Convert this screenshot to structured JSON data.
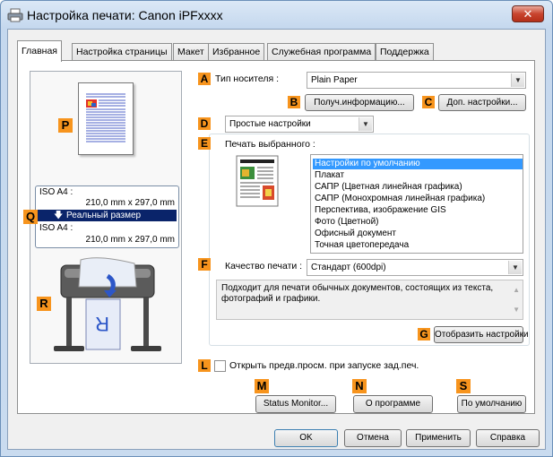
{
  "window": {
    "title": "Настройка печати: Canon iPFxxxx",
    "close_glyph": "✕"
  },
  "tabs": [
    {
      "label": "Главная",
      "active": true
    },
    {
      "label": "Настройка страницы"
    },
    {
      "label": "Макет"
    },
    {
      "label": "Избранное"
    },
    {
      "label": "Служебная программа"
    },
    {
      "label": "Поддержка"
    }
  ],
  "markers": {
    "A": "A",
    "B": "B",
    "C": "C",
    "D": "D",
    "E": "E",
    "F": "F",
    "G": "G",
    "L": "L",
    "M": "M",
    "N": "N",
    "S": "S",
    "P": "P",
    "Q": "Q",
    "R": "R"
  },
  "media": {
    "label": "Тип носителя :",
    "value": "Plain Paper",
    "get_info_button": "Получ.информацию...",
    "advanced_button": "Доп. настройки..."
  },
  "mode": {
    "value": "Простые настройки"
  },
  "print_target": {
    "label": "Печать выбранного :",
    "items": [
      "Настройки по умолчанию",
      "Плакат",
      "САПР (Цветная линейная графика)",
      "САПР (Монохромная линейная графика)",
      "Перспектива, изображение GIS",
      "Фото (Цветной)",
      "Офисный документ",
      "Точная цветопередача"
    ],
    "selected_index": 0
  },
  "quality": {
    "label": "Качество печати :",
    "value": "Стандарт (600dpi)",
    "description": "Подходит для печати обычных документов, состоящих из текста, фотографий и графики.",
    "show_settings_button": "Отобразить настройки"
  },
  "preview_option": {
    "label": "Открыть предв.просм. при запуске зад.печ.",
    "checked": false
  },
  "utility_buttons": {
    "status_monitor": "Status Monitor...",
    "about": "О программе",
    "defaults": "По умолчанию"
  },
  "size_panel": {
    "top_label": "ISO A4 :",
    "top_size": "210,0 mm x 297,0 mm",
    "middle_label": "Реальный размер",
    "bottom_label": "ISO A4 :",
    "bottom_size": "210,0 mm x 297,0 mm"
  },
  "dialog_buttons": {
    "ok": "OK",
    "cancel": "Отмена",
    "apply": "Применить",
    "help": "Справка"
  },
  "colors": {
    "marker": "#f7941d",
    "selection": "#3399ff",
    "size_highlight": "#0a246a"
  },
  "icons": {
    "printer": "printer-icon",
    "close": "close-icon",
    "dropdown": "chevron-down-icon",
    "down_arrow": "arrow-down-icon",
    "doc_preview": "document-preview-icon",
    "plotter": "large-format-printer-illustration"
  }
}
